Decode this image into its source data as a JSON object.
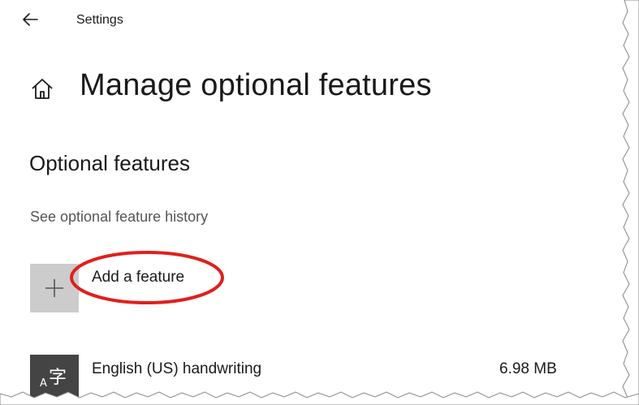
{
  "header": {
    "back_icon": "back-arrow-icon",
    "title": "Settings"
  },
  "page": {
    "home_icon": "home-icon",
    "title": "Manage optional features"
  },
  "optional_features": {
    "heading": "Optional features",
    "history_link": "See optional feature history",
    "add_feature": {
      "icon": "plus-icon",
      "label": "Add a feature",
      "highlight_color": "#e0201b"
    },
    "items": [
      {
        "icon": "handwriting-language-icon",
        "icon_glyph_main": "字",
        "icon_glyph_sub": "A",
        "name": "English (US) handwriting",
        "size": "6.98 MB"
      }
    ]
  },
  "colors": {
    "text": "#1a1a1a",
    "secondary_text": "#555555",
    "tile_background": "#cccccc",
    "feature_icon_background": "#444444"
  }
}
